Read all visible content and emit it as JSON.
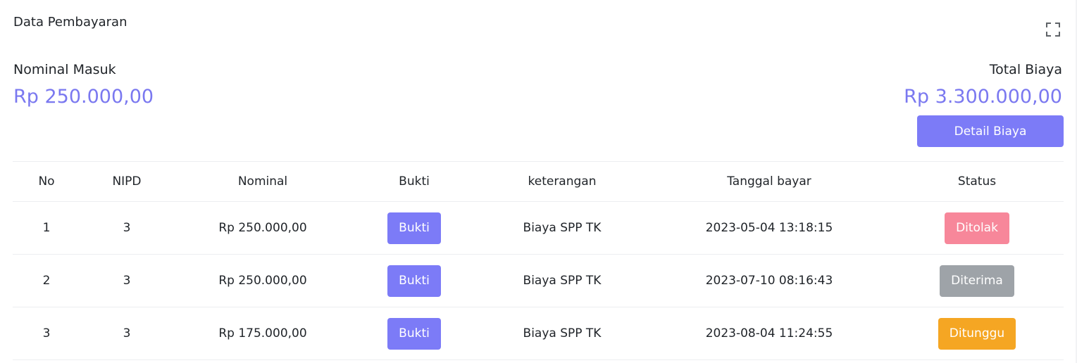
{
  "card": {
    "title": "Data Pembayaran"
  },
  "summary": {
    "nominal_label": "Nominal Masuk",
    "nominal_value": "Rp 250.000,00",
    "total_label": "Total Biaya",
    "total_value": "Rp 3.300.000,00",
    "detail_button": "Detail Biaya"
  },
  "colors": {
    "accent": "#7c7bf7",
    "status_rejected": "#f7879a",
    "status_accepted": "#9ea3a8",
    "status_pending": "#f5a623"
  },
  "icons": {
    "expand": "fullscreen-expand-icon"
  },
  "table": {
    "headers": [
      "No",
      "NIPD",
      "Nominal",
      "Bukti",
      "keterangan",
      "Tanggal bayar",
      "Status"
    ],
    "rows": [
      {
        "no": "1",
        "nipd": "3",
        "nominal": "Rp 250.000,00",
        "bukti": "Bukti",
        "keterangan": "Biaya SPP TK",
        "tanggal": "2023-05-04 13:18:15",
        "status": "Ditolak",
        "status_color": "#f7879a"
      },
      {
        "no": "2",
        "nipd": "3",
        "nominal": "Rp 250.000,00",
        "bukti": "Bukti",
        "keterangan": "Biaya SPP TK",
        "tanggal": "2023-07-10 08:16:43",
        "status": "Diterima",
        "status_color": "#9ea3a8"
      },
      {
        "no": "3",
        "nipd": "3",
        "nominal": "Rp 175.000,00",
        "bukti": "Bukti",
        "keterangan": "Biaya SPP TK",
        "tanggal": "2023-08-04 11:24:55",
        "status": "Ditunggu",
        "status_color": "#f5a623"
      }
    ]
  }
}
